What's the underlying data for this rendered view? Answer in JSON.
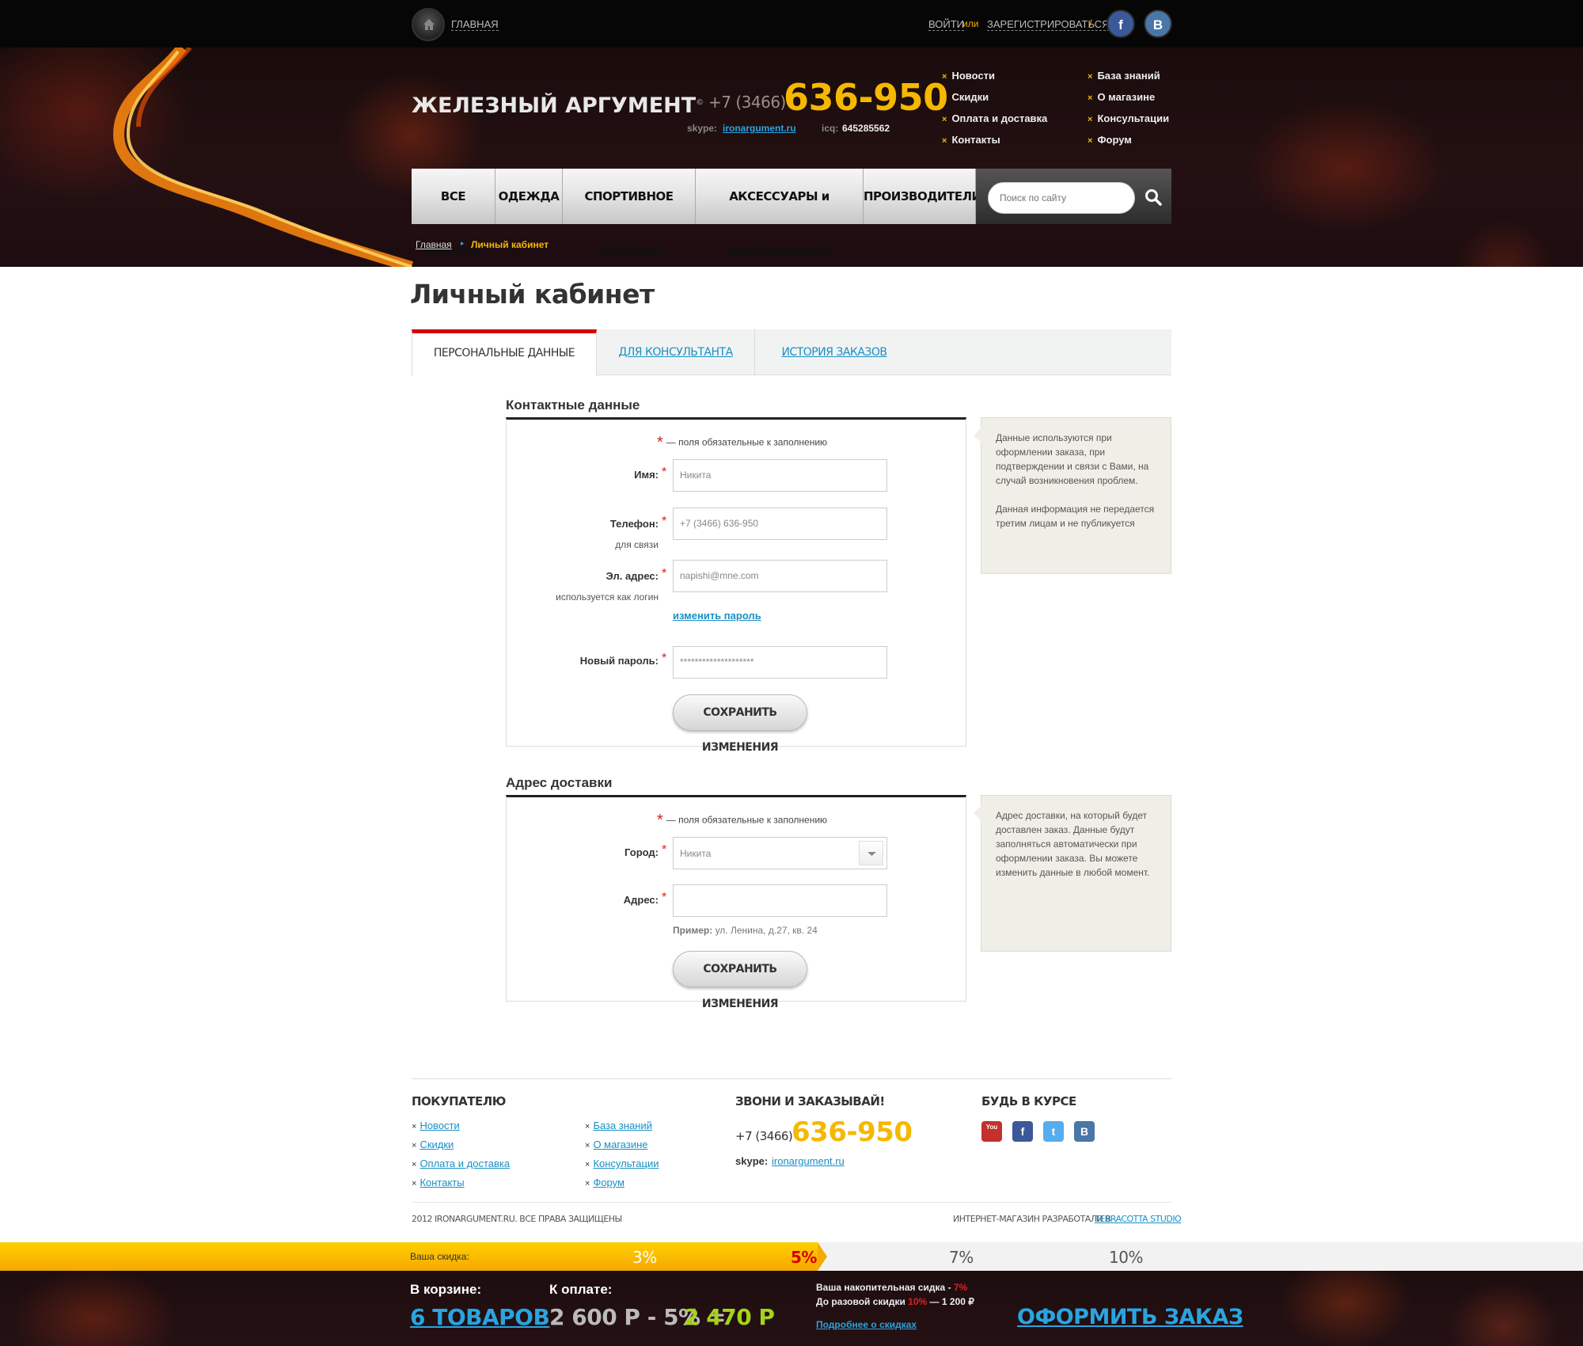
{
  "topbar": {
    "home_label": "ГЛАВНАЯ",
    "login": "ВОЙТИ",
    "or": "или",
    "register": "ЗАРЕГИСТРИРОВАТЬСЯ",
    "slash": "/",
    "social": [
      {
        "icon": "facebook-icon",
        "glyph": "f"
      },
      {
        "icon": "vk-icon",
        "glyph": "B"
      }
    ]
  },
  "header": {
    "logo": "ЖЕЛЕЗНЫЙ АРГУМЕНТ",
    "logo_mark": "©",
    "phone_code": "+7 (3466)",
    "phone_number": "636-950",
    "skype_label": "skype:",
    "skype_value": "ironargument.ru",
    "icq_label": "icq:",
    "icq_value": "645285562",
    "links_col1": [
      "Новости",
      "Скидки",
      "Оплата и доставка",
      "Контакты"
    ],
    "links_col2": [
      "База знаний",
      "О магазине",
      "Консультации",
      "Форум"
    ],
    "marker": "×"
  },
  "nav": {
    "items": [
      "ВСЕ ТОВАРЫ",
      "ОДЕЖДА",
      "СПОРТИВНОЕ ПИТАНИЕ",
      "АКСЕССУАРЫ и ЭКИПИРОВАКА",
      "ПРОИЗВОДИТЕЛИ"
    ],
    "search_placeholder": "Поиск по сайту"
  },
  "breadcrumb": {
    "home": "Главная",
    "sep": "▸",
    "current": "Личный кабинет"
  },
  "page": {
    "title": "Личный кабинет",
    "tabs": [
      "ПЕРСОНАЛЬНЫЕ ДАННЫЕ",
      "ДЛЯ КОНСУЛЬТАНТА",
      "ИСТОРИЯ ЗАКАЗОВ"
    ]
  },
  "contact": {
    "title": "Контактные данные",
    "required_star": "*",
    "required_note": "— поля обязательные к заполнению",
    "name_label": "Имя:",
    "name_value": "Никита",
    "phone_label": "Телефон:",
    "phone_sub": "для связи",
    "phone_value": "+7 (3466) 636-950",
    "email_label": "Эл. адрес:",
    "email_sub": "используется как логин",
    "email_value": "napishi@mne.com",
    "change_password": "изменить пароль",
    "password_label": "Новый пароль:",
    "password_value": "********************",
    "save": "СОХРАНИТЬ ИЗМЕНЕНИЯ",
    "note_p1": "Данные используются при оформлении заказа, при подтверждении и связи с Вами, на случай возникновения проблем.",
    "note_p2": "Данная информация не передается третим лицам и не публикуется"
  },
  "delivery": {
    "title": "Адрес доставки",
    "required_star": "*",
    "required_note": "— поля обязательные к заполнению",
    "city_label": "Город:",
    "city_value": "Никита",
    "address_label": "Адрес:",
    "address_value": "",
    "example_label": "Пример:",
    "example_value": "ул. Ленина, д.27, кв. 24",
    "save": "СОХРАНИТЬ ИЗМЕНЕНИЯ",
    "note": "Адрес доставки, на который будет доставлен заказ. Данные будут заполняться автоматически при оформлении заказа. Вы можете изменить данные в любой момент."
  },
  "footer": {
    "buyer_title": "ПОКУПАТЕЛЮ",
    "links_col1": [
      "Новости",
      "Скидки",
      "Оплата и доставка",
      "Контакты"
    ],
    "links_col2": [
      "База знаний",
      "О магазине",
      "Консультации",
      "Форум"
    ],
    "call_title": "ЗВОНИ И ЗАКАЗЫВАЙ!",
    "phone_code": "+7 (3466)",
    "phone_number": "636-950",
    "skype_label": "skype:",
    "skype_value": "ironargument.ru",
    "follow_title": "БУДЬ В КУРСЕ",
    "social": [
      {
        "icon": "youtube-icon",
        "glyph": "You",
        "color": "#c4302b"
      },
      {
        "icon": "facebook-icon",
        "glyph": "f",
        "color": "#3b5998"
      },
      {
        "icon": "twitter-icon",
        "glyph": "t",
        "color": "#55acee"
      },
      {
        "icon": "vk-icon",
        "glyph": "B",
        "color": "#4a76a8"
      }
    ],
    "copyright": "2012 IRONARGUMENT.RU. ВСЕ ПРАВА ЗАЩИЩЕНЫ",
    "developed_by": "ИНТЕРНЕТ-МАГАЗИН РАЗРАБОТАЛИ В",
    "developer": "TERRACOTTA STUDIO"
  },
  "discount": {
    "label": "Ваша скидка:",
    "steps": [
      "3%",
      "5%",
      "7%",
      "10%"
    ],
    "current": "5%"
  },
  "cart": {
    "in_cart_label": "В корзине:",
    "count": "6 ТОВАРОВ",
    "pay_label": "К оплате:",
    "calculation": "2 600 Р - 5% =",
    "total": "2 470 Р",
    "accumulated_label": "Ваша накопительная сидка -",
    "accumulated_value": "7%",
    "next_label": "До разовой скидки",
    "next_percent": "10%",
    "next_amount": "— 1 200 ₽",
    "more": "Подробнее о скидках",
    "checkout": "ОФОРМИТЬ ЗАКАЗ"
  },
  "colors": {
    "accent": "#f5b800",
    "link": "#1a8fc4",
    "tab_active": "#d40000",
    "total": "#a6d31a"
  }
}
